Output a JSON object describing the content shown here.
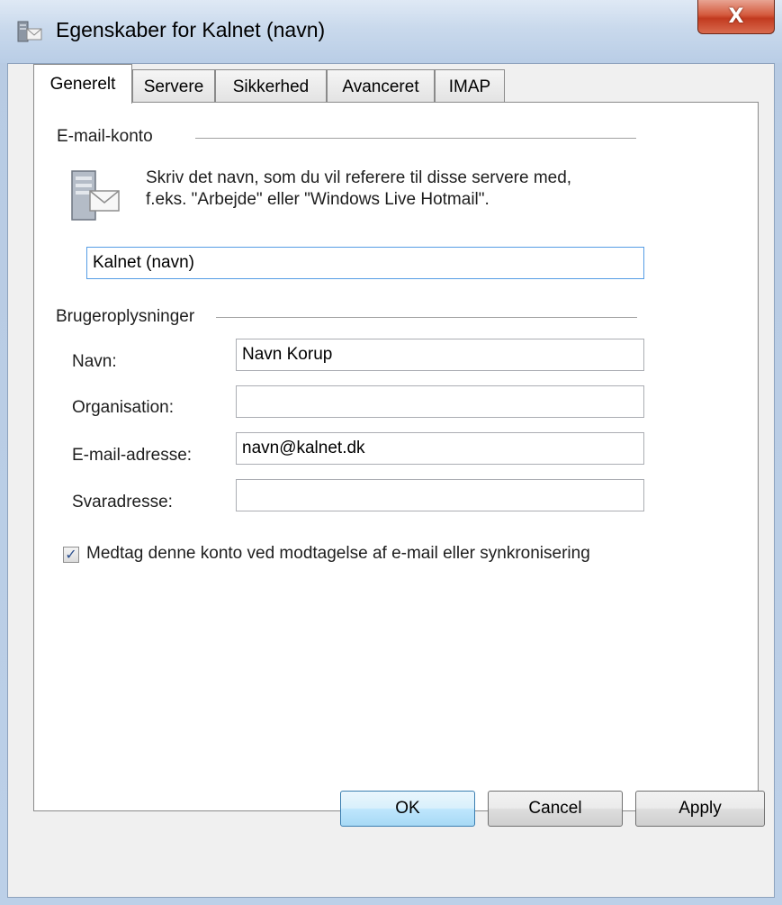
{
  "window": {
    "title": "Egenskaber for Kalnet (navn)",
    "close_label": "X"
  },
  "tabs": [
    {
      "label": "Generelt",
      "active": true
    },
    {
      "label": "Servere",
      "active": false
    },
    {
      "label": "Sikkerhed",
      "active": false
    },
    {
      "label": "Avanceret",
      "active": false
    },
    {
      "label": "IMAP",
      "active": false
    }
  ],
  "email_account": {
    "group_label": "E-mail-konto",
    "description_line1": "Skriv det navn, som du vil referere til disse servere med,",
    "description_line2": "f.eks. \"Arbejde\" eller \"Windows Live Hotmail\".",
    "account_name": "Kalnet (navn)"
  },
  "user_info": {
    "group_label": "Brugeroplysninger",
    "name_label": "Navn:",
    "name_value": "Navn Korup",
    "org_label": "Organisation:",
    "org_value": "",
    "email_label": "E-mail-adresse:",
    "email_value": "navn@kalnet.dk",
    "reply_label": "Svaradresse:",
    "reply_value": ""
  },
  "include_account": {
    "checked": true,
    "check_glyph": "✓",
    "label": "Medtag denne konto ved modtagelse af e-mail eller synkronisering"
  },
  "buttons": {
    "ok": "OK",
    "cancel": "Cancel",
    "apply": "Apply"
  },
  "colors": {
    "focus_border": "#569de5",
    "close_red": "#c23a1f",
    "default_button": "#bee6fd"
  }
}
